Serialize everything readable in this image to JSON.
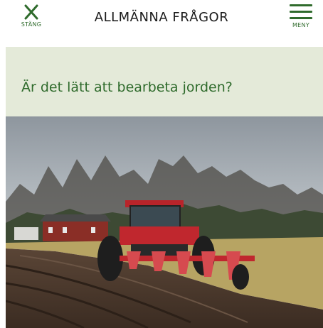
{
  "header": {
    "close_label": "STÄNG",
    "title": "ALLMÄNNA FRÅGOR",
    "menu_label": "MENY"
  },
  "question": {
    "text": "Är det lätt att bearbeta jorden?"
  },
  "image": {
    "subject": "Red tractor plowing a field in front of a red barn and bare trees"
  },
  "colors": {
    "accent_green": "#2f6b2c",
    "panel_background": "#e4ead9"
  }
}
